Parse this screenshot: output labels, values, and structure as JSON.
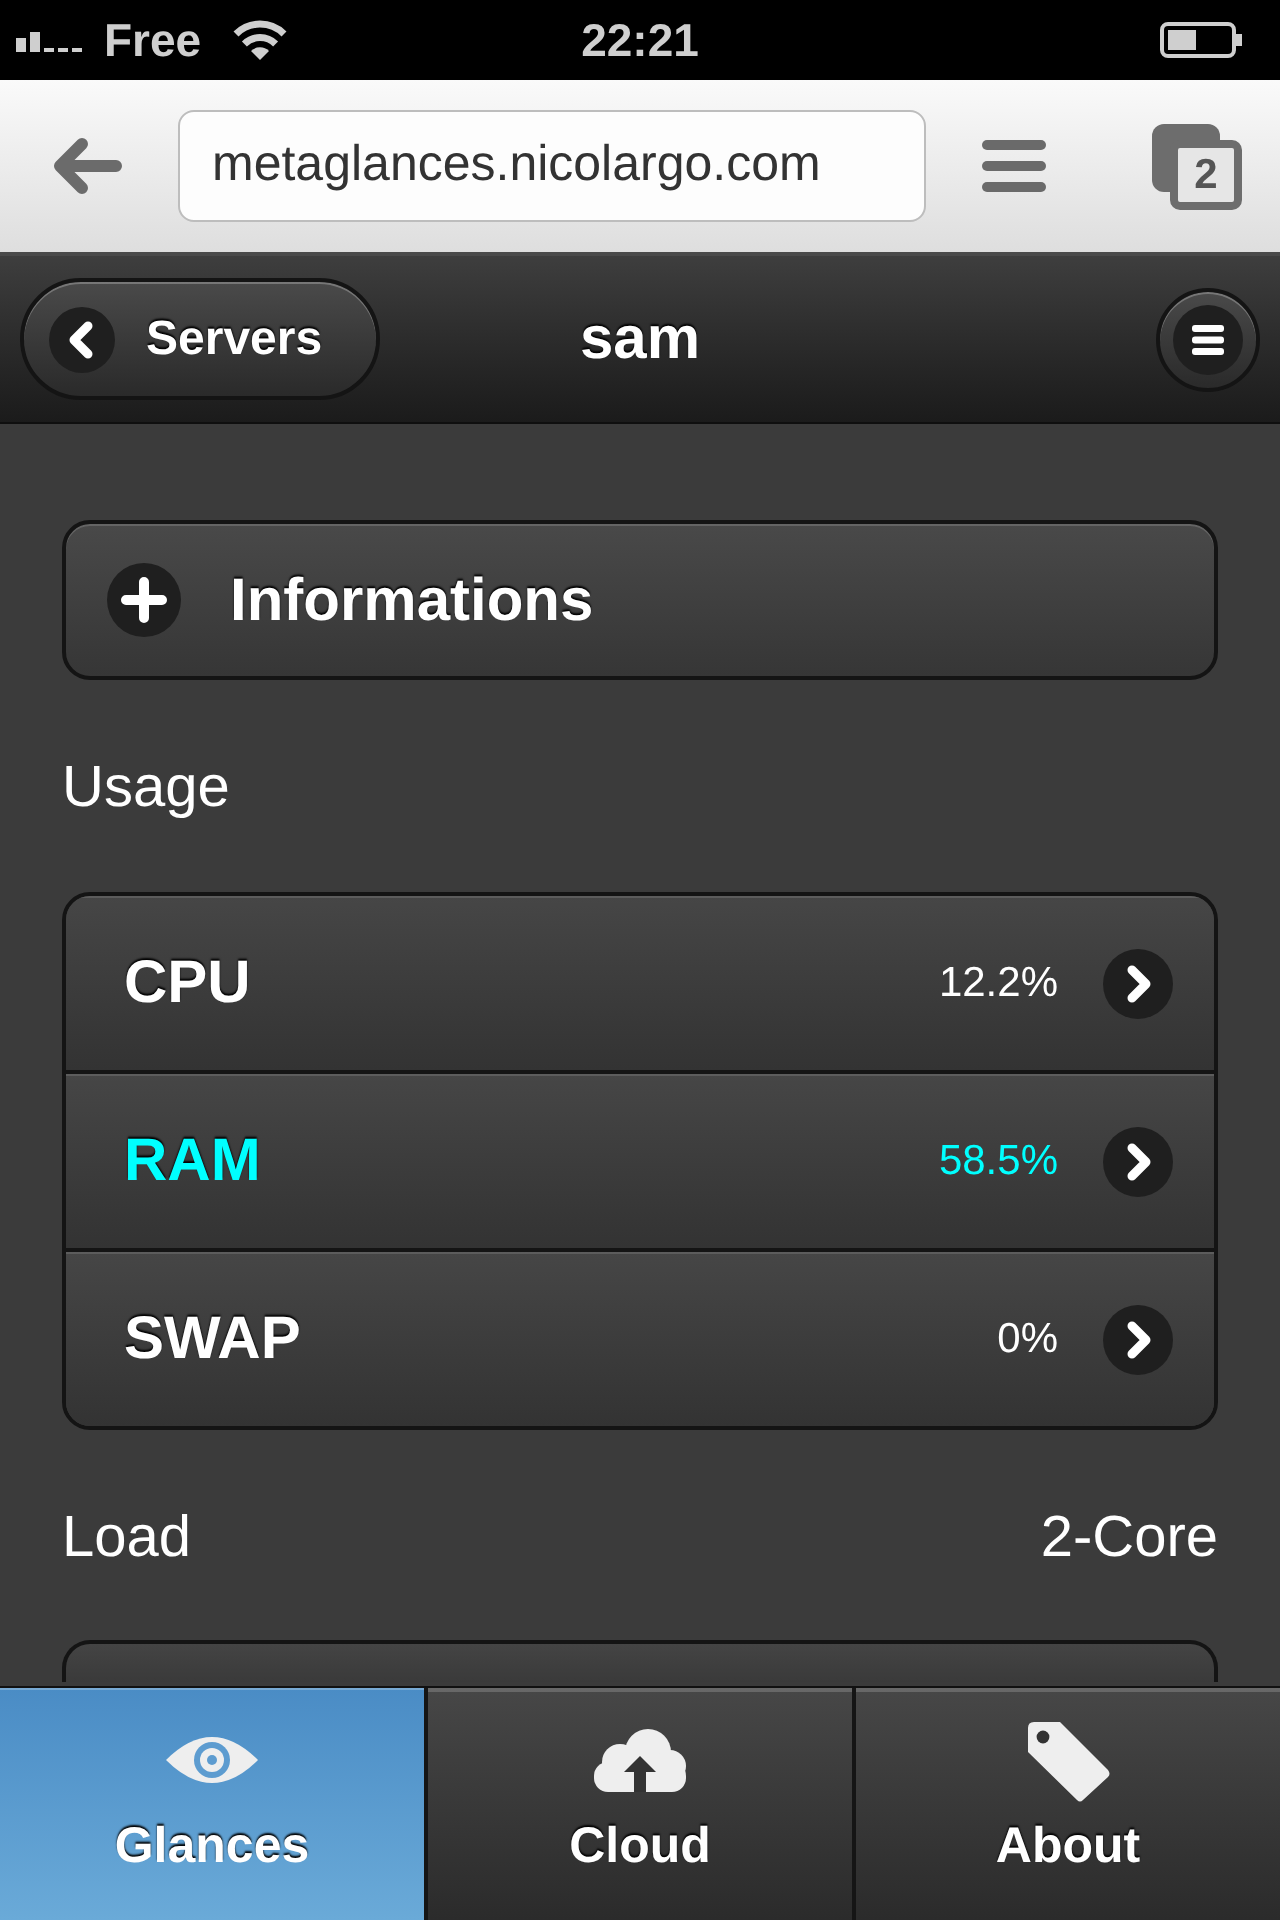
{
  "status_bar": {
    "carrier": "Free",
    "time": "22:21"
  },
  "browser_bar": {
    "url": "metaglances.nicolargo.com",
    "tab_count": "2"
  },
  "header": {
    "back_button": "Servers",
    "title": "sam"
  },
  "informations": {
    "label": "Informations",
    "expanded": false
  },
  "usage": {
    "heading": "Usage",
    "items": [
      {
        "label": "CPU",
        "value": "12.2%",
        "color": "#ffffff"
      },
      {
        "label": "RAM",
        "value": "58.5%",
        "color": "#00ffff"
      },
      {
        "label": "SWAP",
        "value": "0%",
        "color": "#ffffff"
      }
    ]
  },
  "load": {
    "heading": "Load",
    "cores": "2-Core"
  },
  "tab_bar": {
    "tabs": [
      {
        "label": "Glances",
        "selected": true
      },
      {
        "label": "Cloud",
        "selected": false
      },
      {
        "label": "About",
        "selected": false
      }
    ]
  }
}
